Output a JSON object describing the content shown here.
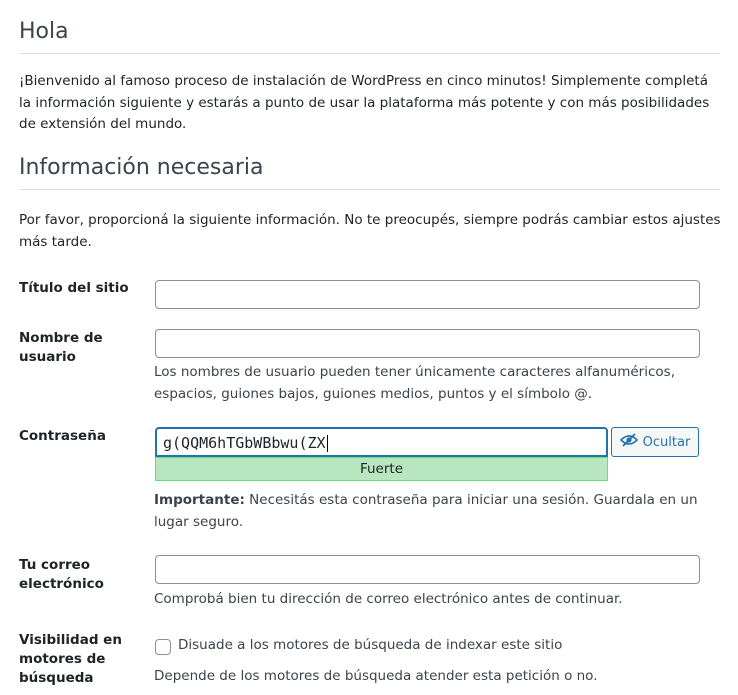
{
  "greeting": {
    "title": "Hola",
    "intro": "¡Bienvenido al famoso proceso de instalación de WordPress en cinco minutos! Simplemente completá la información siguiente y estarás a punto de usar la plataforma más potente y con más posibilidades de extensión del mundo."
  },
  "required": {
    "title": "Información necesaria",
    "intro": "Por favor, proporcioná la siguiente información. No te preocupés, siempre podrás cambiar estos ajustes más tarde."
  },
  "form": {
    "site_title": {
      "label": "Título del sitio",
      "value": ""
    },
    "username": {
      "label": "Nombre de usuario",
      "value": "",
      "description": "Los nombres de usuario pueden tener únicamente caracteres alfanuméricos, espacios, guiones bajos, guiones medios, puntos y el símbolo @."
    },
    "password": {
      "label": "Contraseña",
      "value": "g(QQM6hTGbWBbwu(ZX",
      "strength": "Fuerte",
      "hide_label": "Ocultar",
      "important_prefix": "Importante:",
      "important_text": " Necesitás esta contraseña para iniciar una sesión. Guardala en un lugar seguro."
    },
    "email": {
      "label": "Tu correo electrónico",
      "value": "",
      "description": "Comprobá bien tu dirección de correo electrónico antes de continuar."
    },
    "visibility": {
      "label": "Visibilidad en motores de búsqueda",
      "checkbox_label": "Disuade a los motores de búsqueda de indexar este sitio",
      "checked": false,
      "description": "Depende de los motores de búsqueda atender esta petición o no."
    }
  },
  "colors": {
    "accent": "#2271b1",
    "strength_bg": "#b8e6bf",
    "strength_border": "#68de7c"
  },
  "icons": {
    "hide_password": "eye-slash-icon"
  }
}
